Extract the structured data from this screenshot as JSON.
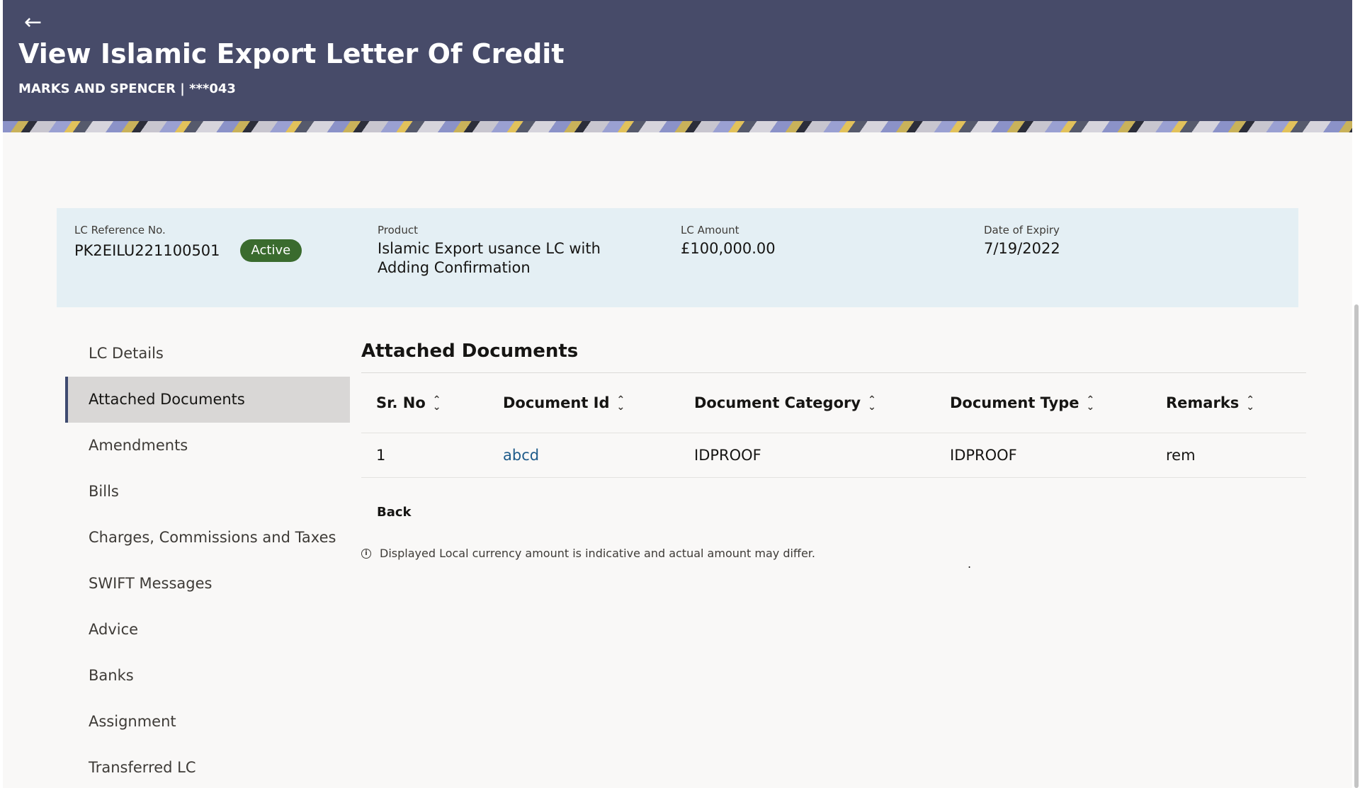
{
  "header": {
    "back_icon": "←",
    "title": "View Islamic Export Letter Of Credit",
    "subtitle": "MARKS AND SPENCER | ***043"
  },
  "summary": {
    "lc_ref_label": "LC Reference No.",
    "lc_ref_value": "PK2EILU221100501",
    "status": "Active",
    "product_label": "Product",
    "product_value": "Islamic Export usance LC with Adding Confirmation",
    "amount_label": "LC Amount",
    "amount_value": "£100,000.00",
    "expiry_label": "Date of Expiry",
    "expiry_value": "7/19/2022"
  },
  "sidenav": {
    "items": [
      {
        "label": "LC Details"
      },
      {
        "label": "Attached Documents"
      },
      {
        "label": "Amendments"
      },
      {
        "label": "Bills"
      },
      {
        "label": "Charges, Commissions and Taxes"
      },
      {
        "label": "SWIFT Messages"
      },
      {
        "label": "Advice"
      },
      {
        "label": "Banks"
      },
      {
        "label": "Assignment"
      },
      {
        "label": "Transferred LC"
      }
    ],
    "active": "Attached Documents"
  },
  "main": {
    "section_title": "Attached Documents",
    "columns": [
      "Sr. No",
      "Document Id",
      "Document Category",
      "Document Type",
      "Remarks"
    ],
    "rows": [
      {
        "sr_no": "1",
        "document_id": "abcd",
        "category": "IDPROOF",
        "type": "IDPROOF",
        "remarks": "rem"
      }
    ],
    "back_label": "Back",
    "disclaimer": "Displayed Local currency amount is indicative and actual amount may differ.",
    "stray_dot": "."
  },
  "colors": {
    "header_bg": "#474b69",
    "summary_bg": "#e4eff4",
    "active_badge": "#3a6b2e",
    "link": "#1e5b8a"
  }
}
